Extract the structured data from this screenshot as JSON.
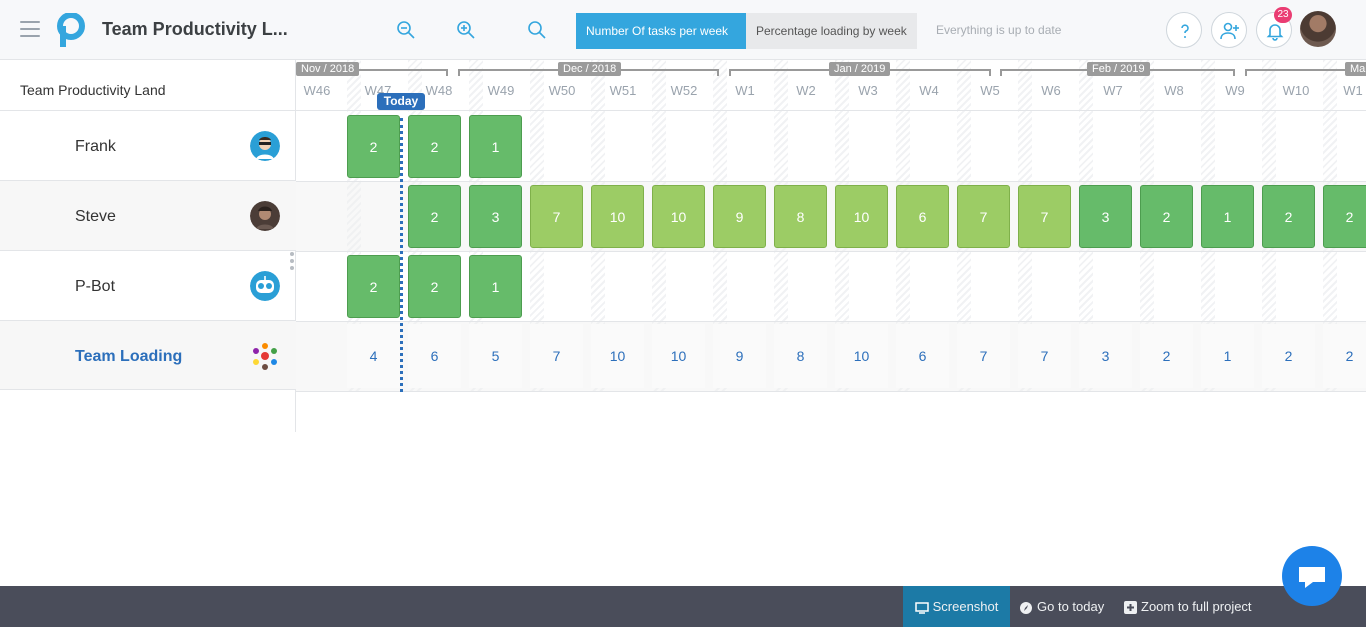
{
  "header": {
    "title": "Team Productivity L...",
    "view_tabs": [
      "Number Of tasks per week",
      "Percentage loading by week"
    ],
    "status": "Everything is up to date",
    "notifications_count": "23",
    "icons": [
      "menu-icon",
      "zoom-out-icon",
      "zoom-in-icon",
      "search-icon",
      "help-icon",
      "add-user-icon",
      "bell-icon"
    ]
  },
  "left_panel": {
    "project_name": "Team Productivity Land",
    "rows": [
      "Frank",
      "Steve",
      "P-Bot",
      "Team Loading"
    ]
  },
  "timeline": {
    "months": [
      "Nov / 2018",
      "Dec / 2018",
      "Jan / 2019",
      "Feb / 2019",
      "Ma"
    ],
    "weeks": [
      "W46",
      "W47",
      "W48",
      "W49",
      "W50",
      "W51",
      "W52",
      "W1",
      "W2",
      "W3",
      "W4",
      "W5",
      "W6",
      "W7",
      "W8",
      "W9",
      "W10",
      "W1"
    ],
    "today_label": "Today"
  },
  "tasks": {
    "frank": [
      "2",
      "2",
      "1"
    ],
    "steve": [
      "2",
      "3",
      "7",
      "10",
      "10",
      "9",
      "8",
      "10",
      "6",
      "7",
      "7",
      "3",
      "2",
      "1",
      "2",
      "2"
    ],
    "pbot": [
      "2",
      "2",
      "1"
    ],
    "team": [
      "4",
      "6",
      "5",
      "7",
      "10",
      "10",
      "9",
      "8",
      "10",
      "6",
      "7",
      "7",
      "3",
      "2",
      "1",
      "2",
      "2"
    ]
  },
  "footer": {
    "screenshot": "Screenshot",
    "go_today": "Go to today",
    "zoom_full": "Zoom to full project"
  },
  "colors": {
    "accent": "#34a6de",
    "bar_dark": "#66bb6a",
    "bar_light": "#9ccc65",
    "today": "#2c6fbb",
    "footer_bg": "#4a4d5a"
  }
}
